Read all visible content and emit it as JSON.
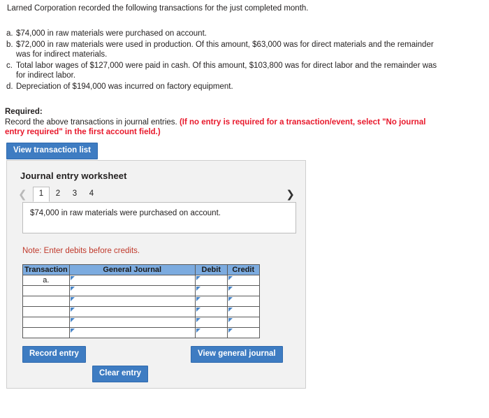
{
  "intro": {
    "text": "Larned Corporation recorded the following transactions for the just completed month."
  },
  "transactions": [
    {
      "letter": "a.",
      "text": "$74,000 in raw materials were purchased on account."
    },
    {
      "letter": "b.",
      "text": "$72,000 in raw materials were used in production. Of this amount, $63,000 was for direct materials and the remainder was for indirect materials."
    },
    {
      "letter": "c.",
      "text": "Total labor wages of $127,000 were paid in cash. Of this amount, $103,800 was for direct labor and the remainder was for indirect labor."
    },
    {
      "letter": "d.",
      "text": "Depreciation of $194,000 was incurred on factory equipment."
    }
  ],
  "required": {
    "label": "Required:",
    "instruction": "Record the above transactions in journal entries.",
    "emphasis": "(If no entry is required for a transaction/event, select \"No journal entry required\" in the first account field.)"
  },
  "buttons": {
    "view_transaction_list": "View transaction list",
    "record_entry": "Record entry",
    "clear_entry": "Clear entry",
    "view_general_journal": "View general journal"
  },
  "worksheet": {
    "title": "Journal entry worksheet",
    "prev_icon": "chevron-left-icon",
    "next_icon": "chevron-right-icon",
    "tabs": [
      {
        "label": "1",
        "active": true
      },
      {
        "label": "2",
        "active": false
      },
      {
        "label": "3",
        "active": false
      },
      {
        "label": "4",
        "active": false
      }
    ],
    "prompt": "$74,000 in raw materials were purchased on account.",
    "note": "Note: Enter debits before credits."
  },
  "journal_table": {
    "headers": [
      "Transaction",
      "General Journal",
      "Debit",
      "Credit"
    ],
    "rows": [
      {
        "transaction": "a.",
        "general_journal": "",
        "debit": "",
        "credit": ""
      },
      {
        "transaction": "",
        "general_journal": "",
        "debit": "",
        "credit": ""
      },
      {
        "transaction": "",
        "general_journal": "",
        "debit": "",
        "credit": ""
      },
      {
        "transaction": "",
        "general_journal": "",
        "debit": "",
        "credit": ""
      },
      {
        "transaction": "",
        "general_journal": "",
        "debit": "",
        "credit": ""
      },
      {
        "transaction": "",
        "general_journal": "",
        "debit": "",
        "credit": ""
      }
    ]
  },
  "colors": {
    "button_blue": "#3e7cc2",
    "table_header_blue": "#7cabdf",
    "warning_red": "#e8192c",
    "note_red": "#c0392b",
    "panel_background": "#f2f2f2"
  }
}
